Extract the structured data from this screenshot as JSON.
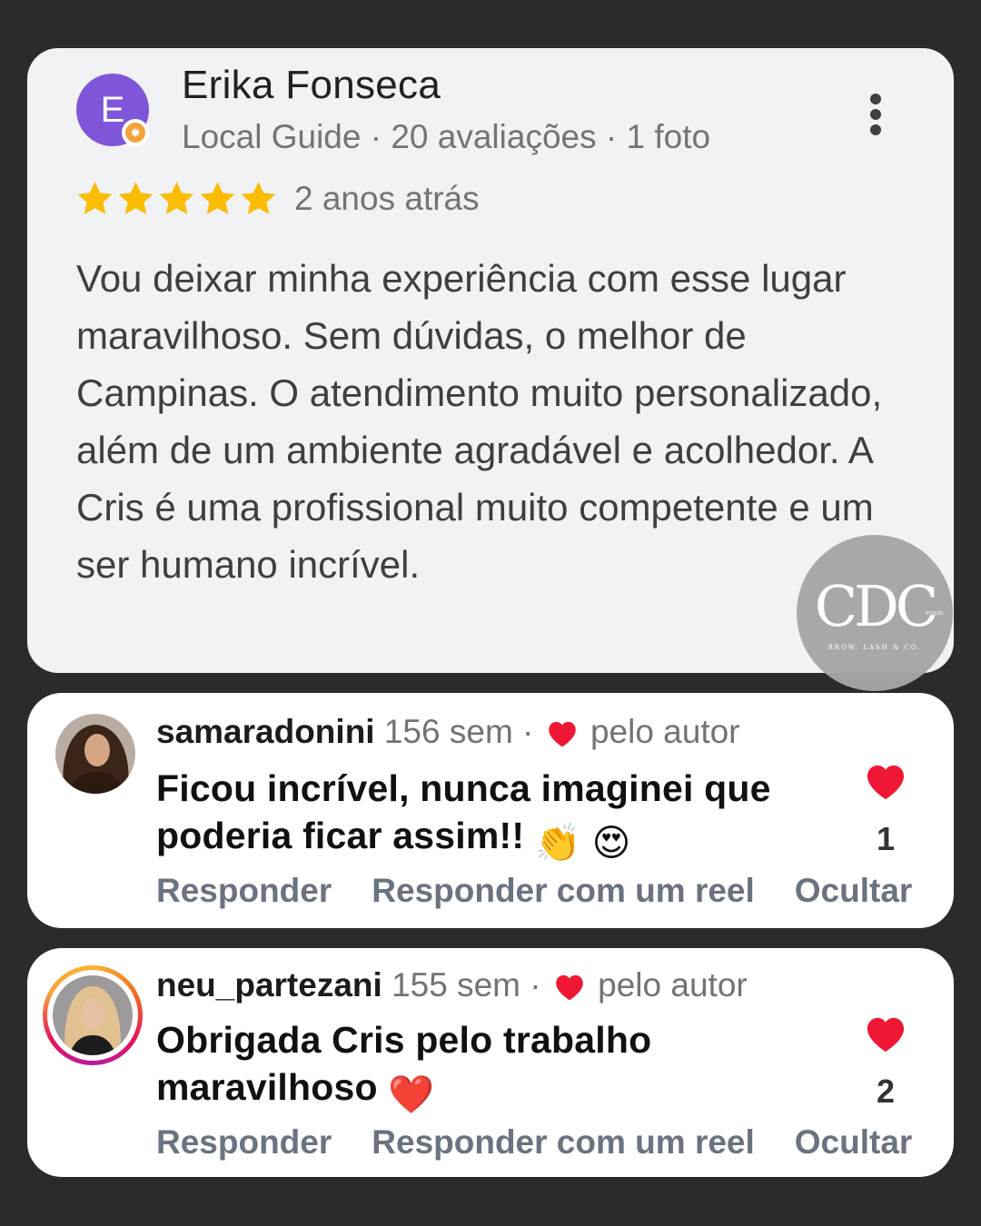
{
  "review": {
    "avatar_letter": "E",
    "name": "Erika Fonseca",
    "meta": "Local Guide · 20 avaliações · 1 foto",
    "rating": 5,
    "time": "2 anos atrás",
    "text": "Vou deixar minha experiência com esse lugar maravilhoso. Sem dúvidas, o melhor de Campinas. O atendimento muito personalizado, além de um ambiente agradável e acolhedor. A Cris é uma profissional muito competente e um ser humano incrível.",
    "star_color": "#fbbc04",
    "avatar_color": "#7f56d9"
  },
  "logo": {
    "main": "CDC",
    "subtitle": "BROW, LASH & CO.",
    "studio": "STUDIO"
  },
  "comments": [
    {
      "username": "samaradonini",
      "time": "156 sem ·",
      "liked_by": "pelo autor",
      "text": "Ficou incrível, nunca imaginei que poderia ficar assim!!",
      "emojis": "👏 😍",
      "likes": "1",
      "actions": [
        "Responder",
        "Responder com um reel",
        "Ocultar"
      ]
    },
    {
      "username": "neu_partezani",
      "time": "155 sem ·",
      "liked_by": "pelo autor",
      "text": "Obrigada Cris pelo trabalho maravilhoso",
      "emojis": "❤️",
      "likes": "2",
      "actions": [
        "Responder",
        "Responder com um reel",
        "Ocultar"
      ]
    }
  ],
  "icons": {
    "more": "more-vert-icon",
    "star": "star-icon",
    "heart": "heart-icon"
  },
  "colors": {
    "background": "#2b2b2c",
    "heart": "#ef1733"
  }
}
